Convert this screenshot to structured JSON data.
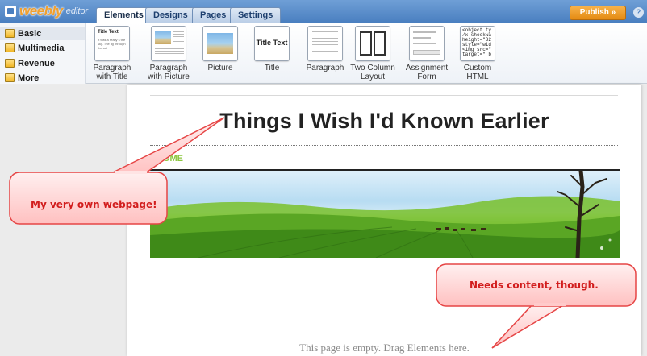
{
  "app": {
    "brand": "weebly",
    "brand_suffix": "editor"
  },
  "tabs": [
    "Elements",
    "Designs",
    "Pages",
    "Settings"
  ],
  "publish_label": "Publish »",
  "help_label": "?",
  "categories": [
    "Basic",
    "Multimedia",
    "Revenue",
    "More"
  ],
  "elements": [
    {
      "label": "Paragraph\nwith Title",
      "thumb_title": "Title Text",
      "thumb_text": "It was a really s the sky. The lig through the sst"
    },
    {
      "label": "Paragraph\nwith Picture"
    },
    {
      "label": "Picture"
    },
    {
      "label": "Title",
      "thumb_title": "Title Text"
    },
    {
      "label": "Paragraph"
    },
    {
      "label": "Two Column\nLayout"
    },
    {
      "label": "Assignment\nForm"
    },
    {
      "label": "Custom\nHTML",
      "thumb_code": "<object ty\n/x-shockwa\nheight=\"32\nstyle=\"wid\n<img src=\"\ntarget=\"_b"
    }
  ],
  "page": {
    "title": "Things I Wish I'd Known Earlier",
    "nav_home": "HOME",
    "empty_message": "This page is empty. Drag Elements here."
  },
  "callouts": [
    {
      "text": "My very own webpage!"
    },
    {
      "text": "Needs content, though."
    }
  ],
  "colors": {
    "accent_nav": "#8cc63f",
    "callout_text": "#d21d1d",
    "publish": "#e48a12"
  }
}
